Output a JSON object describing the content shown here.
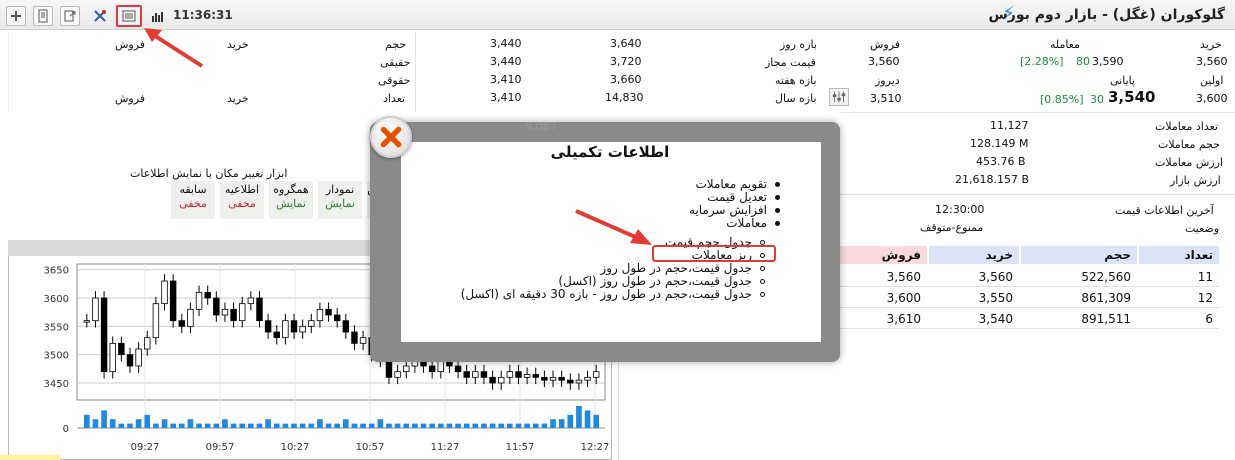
{
  "toolbar": {
    "clock": "11:36:31",
    "title": "گلوکوران (غگل) - بازار دوم بورس"
  },
  "info_left": {
    "col_headers": {
      "sell": "فروش",
      "buy": "خرید",
      "volume": "حجم"
    },
    "rows": [
      {
        "label": "حقیقی",
        "v1": "3,440",
        "v2": "3,720",
        "label2": "قیمت مجاز"
      },
      {
        "label": "حقوقی",
        "v1": "3,410",
        "v2": "3,660",
        "label2": "بازه هفته"
      }
    ],
    "row0": {
      "v1": "3,440",
      "v2": "3,640",
      "label2": "بازه روز"
    },
    "row3": {
      "label": "تعداد",
      "v1": "3,410",
      "v2": "14,830",
      "label2": "بازه سال",
      "buy": "خرید",
      "sell": "فروش"
    }
  },
  "quote": {
    "sell_label": "فروش",
    "deal_label": "معامله",
    "buy_label": "خرید",
    "first_label": "اولین",
    "last_label": "پایانی",
    "yesterday_label": "دیروز",
    "sell_val": "3,560",
    "deal_val": "3,590",
    "deal_change": "[2.28%]",
    "deal_change_abs": "80",
    "buy_val": "3,560",
    "yesterday_val": "3,510",
    "last_val": "3,540",
    "last_change": "[0.85%]",
    "last_change_abs": "30",
    "first_val": "3,600"
  },
  "stats": [
    {
      "label": "تعداد معاملات",
      "value": "11,127"
    },
    {
      "label": "حجم معاملات",
      "value": "128.149 M"
    },
    {
      "label": "ارزش معاملات",
      "value": "453.76 B"
    },
    {
      "label": "ارزش بازار",
      "value": "21,618.157 B"
    }
  ],
  "status": {
    "last_info_label": "آخرین اطلاعات قیمت",
    "last_info_value": "12:30:00",
    "state_label": "وضعیت",
    "state_value": "ممنوع-متوقف"
  },
  "tools": {
    "caption": "ابزار تغییر مکان یا نمایش اطلاعات",
    "items": [
      {
        "name": "سابقه",
        "state": "مخفی",
        "kind": "hide"
      },
      {
        "name": "اطلاعیه",
        "state": "مخفی",
        "kind": "hide"
      },
      {
        "name": "همگروه",
        "state": "نمایش",
        "kind": "show"
      },
      {
        "name": "نمودار",
        "state": "نمایش",
        "kind": "show"
      },
      {
        "name": "ش",
        "state": "ن",
        "kind": "show"
      }
    ]
  },
  "trades_table": {
    "headers": {
      "count": "تعداد",
      "volume": "حجم",
      "buy": "خرید",
      "sell": "فروش"
    },
    "rows": [
      {
        "count": "11",
        "volume": "522,560",
        "buy": "3,560",
        "sell": "3,560"
      },
      {
        "count": "12",
        "volume": "861,309",
        "buy": "3,550",
        "sell": "3,600"
      },
      {
        "count": "6",
        "volume": "891,511",
        "buy": "3,540",
        "sell": "3,610"
      }
    ]
  },
  "modal": {
    "title": "اطلاعات تکمیلی",
    "items": [
      "تقویم معاملات",
      "تعدیل قیمت",
      "افزایش سرمایه",
      "معاملات"
    ],
    "subitems": [
      "جدول حجم قیمت",
      "ریز معاملات",
      "جدول قیمت،حجم در طول روز",
      "جدول قیمت،حجم در طول روز (اکسل)",
      "جدول قیمت،حجم در طول روز - بازه 30 دقیقه ای (اکسل)"
    ],
    "partial_value": "9,087"
  },
  "chart_data": {
    "type": "candlestick",
    "y_ticks": [
      "3650",
      "3600",
      "3550",
      "3500",
      "3450"
    ],
    "ylim": [
      3420,
      3660
    ],
    "x_ticks": [
      "09:27",
      "09:57",
      "10:27",
      "10:57",
      "11:27",
      "11:57",
      "12:27"
    ],
    "volume_axis_label": "0",
    "colors": {
      "candle": "#000000",
      "volume": "#1e88e5"
    },
    "closes": [
      3560,
      3600,
      3470,
      3520,
      3500,
      3480,
      3510,
      3530,
      3590,
      3630,
      3560,
      3550,
      3580,
      3610,
      3600,
      3570,
      3580,
      3560,
      3590,
      3600,
      3560,
      3540,
      3530,
      3560,
      3540,
      3550,
      3560,
      3580,
      3570,
      3560,
      3540,
      3520,
      3530,
      3500,
      3490,
      3460,
      3470,
      3480,
      3500,
      3480,
      3470,
      3490,
      3480,
      3470,
      3460,
      3470,
      3460,
      3450,
      3460,
      3470,
      3460,
      3465,
      3460,
      3455,
      3460,
      3455,
      3450,
      3455,
      3460,
      3470
    ],
    "volumes": [
      3,
      2,
      4,
      2,
      1,
      1,
      2,
      3,
      1,
      2,
      1,
      1,
      2,
      1,
      1,
      1,
      2,
      1,
      1,
      1,
      1,
      2,
      1,
      1,
      1,
      1,
      1,
      2,
      1,
      1,
      2,
      1,
      1,
      1,
      2,
      1,
      1,
      1,
      1,
      1,
      1,
      1,
      1,
      1,
      1,
      1,
      1,
      1,
      1,
      1,
      1,
      1,
      1,
      1,
      2,
      2,
      3,
      5,
      4,
      3
    ]
  }
}
